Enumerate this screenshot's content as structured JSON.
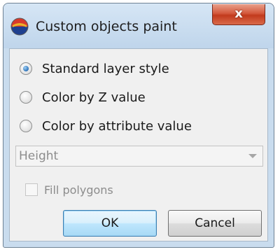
{
  "window": {
    "title": "Custom objects paint",
    "close_label": "x",
    "icon": "app-icon"
  },
  "paint_mode": {
    "options": [
      {
        "label": "Standard layer style",
        "checked": true
      },
      {
        "label": "Color by Z value",
        "checked": false
      },
      {
        "label": "Color by attribute value",
        "checked": false
      }
    ]
  },
  "attribute_select": {
    "value": "Height",
    "enabled": false
  },
  "fill_polygons": {
    "label": "Fill polygons",
    "checked": false,
    "enabled": false
  },
  "buttons": {
    "ok_label": "OK",
    "cancel_label": "Cancel"
  },
  "colors": {
    "frame": "#c9dcee",
    "client": "#f0f0f0",
    "close_button": "#c23a1d",
    "disabled_text": "#8c8c8c"
  }
}
